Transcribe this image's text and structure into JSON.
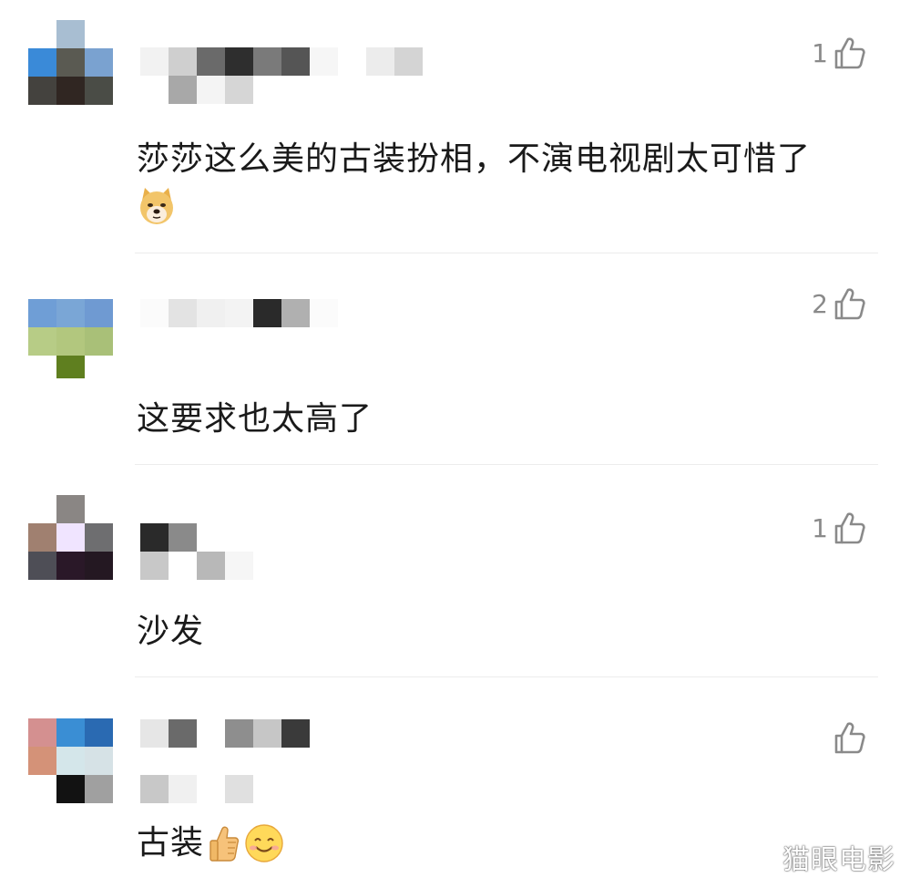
{
  "comments": [
    {
      "likes": "1",
      "text": "莎莎这么美的古装扮相，不演电视剧太可惜了",
      "emojis": [
        "doge"
      ]
    },
    {
      "likes": "2",
      "text": "这要求也太高了"
    },
    {
      "likes": "1",
      "text": "沙发"
    },
    {
      "likes": "",
      "text": "古装",
      "emojis": [
        "thumbs-up",
        "smile"
      ]
    }
  ],
  "watermark": "猫眼电影",
  "icons": {
    "like": "thumbs-up-outline-icon"
  }
}
